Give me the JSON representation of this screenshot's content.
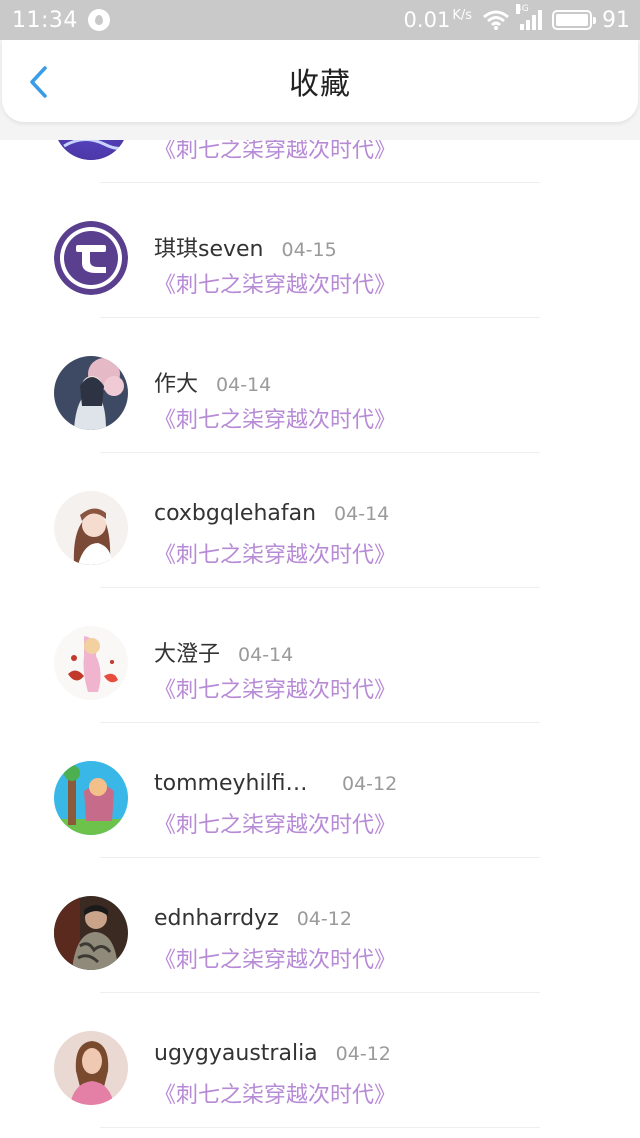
{
  "status_bar": {
    "time": "11:34",
    "net_speed": "0.01",
    "net_unit": "K/s",
    "network_type": "4G",
    "battery": "91",
    "icons": [
      "notification-drop-icon",
      "wifi-icon",
      "signal-icon",
      "battery-icon"
    ]
  },
  "header": {
    "title": "收藏",
    "back_icon": "chevron-left-icon"
  },
  "colors": {
    "accent_blue": "#3a9be6",
    "book_title_purple": "#b78ad6",
    "status_bar_gray": "#c9c9c9"
  },
  "favorites": [
    {
      "username": "",
      "date": "",
      "book_title": "《刺七之柒穿越次时代》",
      "avatar": "blue-abstract"
    },
    {
      "username": "琪琪seven",
      "date": "04-15",
      "book_title": "《刺七之柒穿越次时代》",
      "avatar": "purple-t-logo"
    },
    {
      "username": "作大",
      "date": "04-14",
      "book_title": "《刺七之柒穿越次时代》",
      "avatar": "anime-girl-blossom"
    },
    {
      "username": "coxbgqlehafan",
      "date": "04-14",
      "book_title": "《刺七之柒穿越次时代》",
      "avatar": "girl-portrait"
    },
    {
      "username": "大澄子",
      "date": "04-14",
      "book_title": "《刺七之柒穿越次时代》",
      "avatar": "splash-art"
    },
    {
      "username": "tommeyhilfiwg...",
      "date": "04-12",
      "book_title": "《刺七之柒穿越次时代》",
      "avatar": "cartoon-character"
    },
    {
      "username": "ednharrdyz",
      "date": "04-12",
      "book_title": "《刺七之柒穿越次时代》",
      "avatar": "tattooed-man"
    },
    {
      "username": "ugygyaustralia",
      "date": "04-12",
      "book_title": "《刺七之柒穿越次时代》",
      "avatar": "woman-portrait"
    }
  ]
}
